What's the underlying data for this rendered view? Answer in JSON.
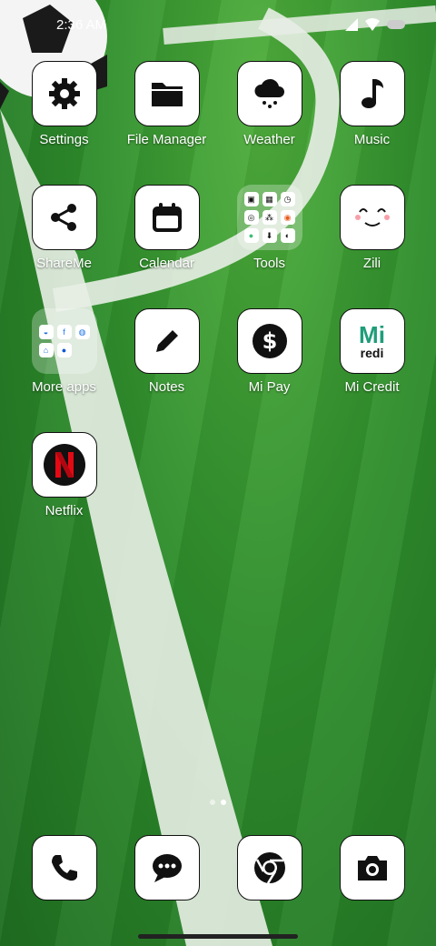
{
  "status_bar": {
    "time": "2:36 AM"
  },
  "apps": [
    {
      "label": "Settings"
    },
    {
      "label": "File Manager"
    },
    {
      "label": "Weather"
    },
    {
      "label": "Music"
    },
    {
      "label": "ShareMe"
    },
    {
      "label": "Calendar"
    },
    {
      "label": "Tools"
    },
    {
      "label": "Zili"
    },
    {
      "label": "More apps"
    },
    {
      "label": "Notes"
    },
    {
      "label": "Mi Pay"
    },
    {
      "label": "Mi Credit",
      "icon_text": "Mi",
      "icon_subtext": "redi"
    },
    {
      "label": "Netflix"
    }
  ],
  "dock": [
    {
      "icon": "phone-icon"
    },
    {
      "icon": "messages-icon"
    },
    {
      "icon": "chrome-icon"
    },
    {
      "icon": "camera-icon"
    }
  ],
  "pages": {
    "count": 2,
    "active": 2
  }
}
